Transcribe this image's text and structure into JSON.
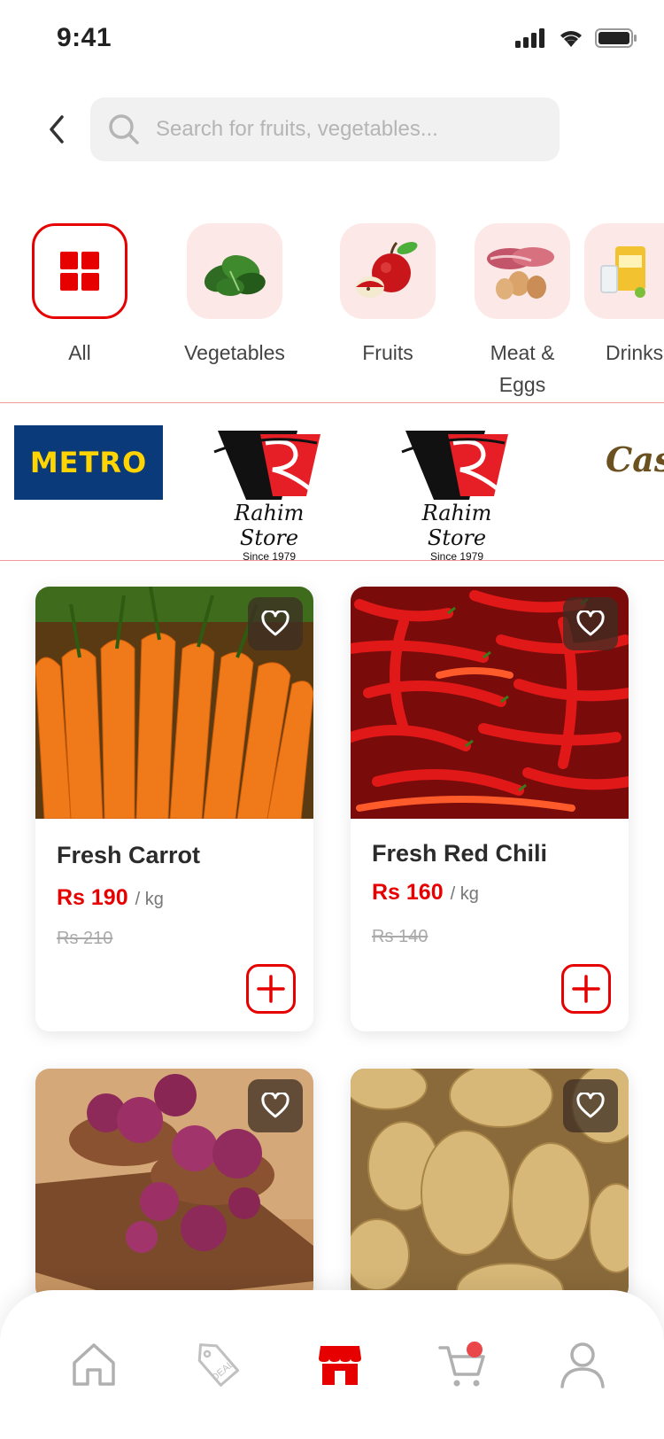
{
  "status_bar": {
    "time": "9:41"
  },
  "search": {
    "placeholder": "Search for fruits, vegetables..."
  },
  "categories": [
    {
      "label": "All",
      "icon": "grid-icon",
      "active": true
    },
    {
      "label": "Vegetables",
      "icon": "vegetables-image"
    },
    {
      "label": "Fruits",
      "icon": "fruits-image"
    },
    {
      "label": "Meat & Eggs",
      "icon": "meat-eggs-image"
    },
    {
      "label": "Drinks",
      "icon": "drinks-image"
    }
  ],
  "brands": [
    {
      "name": "METRO"
    },
    {
      "name": "Rahim Store",
      "sub": "Since 1979"
    },
    {
      "name": "Rahim Store",
      "sub": "Since 1979"
    },
    {
      "name": "Cash"
    }
  ],
  "products": [
    {
      "name": "Fresh Carrot",
      "price": "Rs 190",
      "unit": "/ kg",
      "old_price": "Rs 210"
    },
    {
      "name": "Fresh Red Chili",
      "price": "Rs 160",
      "unit": "/ kg",
      "old_price": "Rs 140"
    },
    {
      "name": "",
      "price": "",
      "unit": "",
      "old_price": ""
    },
    {
      "name": "",
      "price": "",
      "unit": "",
      "old_price": ""
    }
  ],
  "bottom_nav": [
    {
      "icon": "home-icon"
    },
    {
      "icon": "deal-tag-icon"
    },
    {
      "icon": "store-icon",
      "active": true
    },
    {
      "icon": "cart-icon",
      "badge": true
    },
    {
      "icon": "profile-icon"
    }
  ],
  "colors": {
    "accent": "#e60000",
    "tile_bg": "#fde8e8",
    "divider": "#f09a9a"
  }
}
